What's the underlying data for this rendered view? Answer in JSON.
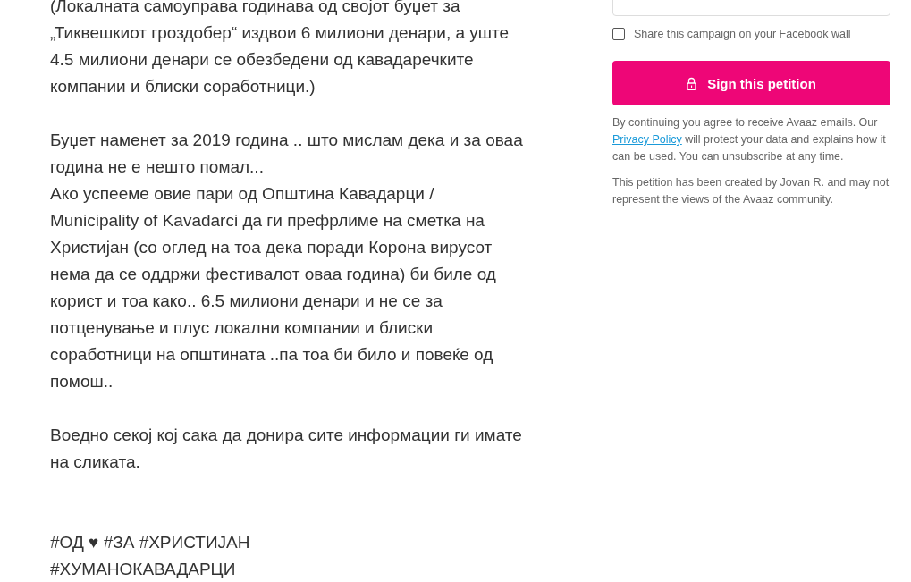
{
  "story": {
    "paragraphs": [
      [
        "(Локалната самоуправа годинава од својот буџет за",
        "„Тиквешкиот гроздобер“ издвои 6 милиони денари, а уште",
        "4.5 милиони денари се обезбедени од кавадаречките",
        "компании и блиски соработници.)"
      ],
      [
        "Буџет наменет за 2019 година .. што мислам дека и за оваа",
        "година не е нешто помал...",
        "Ако успееме овие пари од Општина Кавадарци /",
        "Municipality of Kavadarci да ги префрлиме на сметка на",
        "Христијан (со оглед на тоа дека поради Корона вирусот",
        "нема да се оддржи фестивалот оваа година) би биле од",
        "корист и тоа како.. 6.5 милиони денари и не се за",
        "потценување и плус локални компании и блиски",
        "соработници на општината ..па тоа би било и повеќе од",
        "помош.."
      ],
      [
        "Воедно секој кој сака да донира сите информации ги имате",
        "на сликата."
      ],
      [
        "#ОД ♥ #ЗА #ХРИСТИЈАН",
        "#ХУМАНОКАВАДАРЦИ"
      ]
    ]
  },
  "form": {
    "share_checkbox": {
      "label": "Share this campaign on your Facebook wall",
      "checked": false
    },
    "sign_button": "Sign this petition",
    "consent": {
      "before": "By continuing you agree to receive Avaaz emails. Our ",
      "link": "Privacy Policy",
      "after": " will protect your data and explains how it can be used. You can unsubscribe at any time."
    },
    "disclaimer": "This petition has been created by Jovan R. and may not represent the views of the Avaaz community."
  }
}
